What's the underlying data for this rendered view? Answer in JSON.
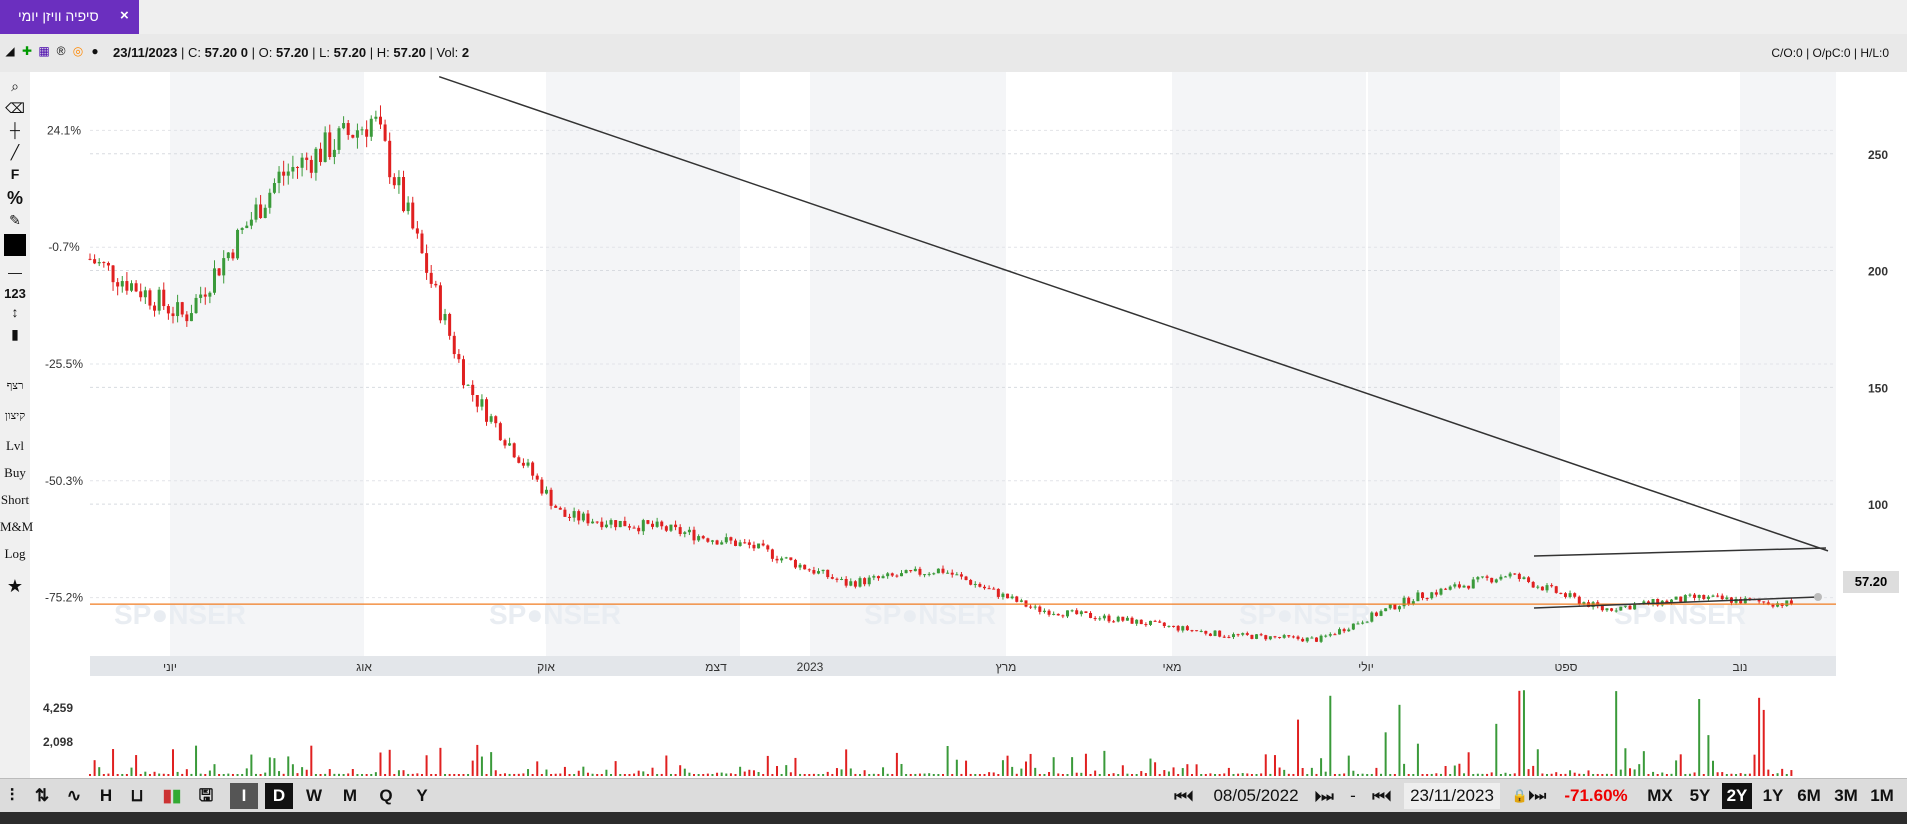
{
  "tab": {
    "title": "סיפיה וויזן יומי",
    "close_icon": "×"
  },
  "info": {
    "date": "23/11/2023",
    "c_label": "C:",
    "c_value": "57.20",
    "c_change": "0",
    "o_label": "O:",
    "o_value": "57.20",
    "l_label": "L:",
    "l_value": "57.20",
    "h_label": "H:",
    "h_value": "57.20",
    "vol_label": "Vol:",
    "vol_value": "2",
    "right": "C/O:0 | O/pC:0 | H/L:0"
  },
  "left_tools": [
    "F",
    "%",
    "123",
    "רצף",
    "קיצון",
    "Lvl",
    "Buy",
    "Short",
    "M&M",
    "Log"
  ],
  "left_axis": [
    "24.1%",
    "-0.7%",
    "-25.5%",
    "-50.3%",
    "-75.2%"
  ],
  "right_axis": [
    "250",
    "200",
    "150",
    "100"
  ],
  "price_tag": "57.20",
  "x_labels": [
    "יוני",
    "אוג",
    "אוק",
    "דצמ",
    "2023",
    "מרץ",
    "מאי",
    "יולי",
    "ספט",
    "נוב"
  ],
  "volume_axis": [
    "4,259",
    "2,098"
  ],
  "watermark": "SP●NSER",
  "bottom": {
    "periods": [
      "D",
      "W",
      "M",
      "Q",
      "Y"
    ],
    "from_date": "08/05/2022",
    "sep": "-",
    "to_date": "23/11/2023",
    "change": "-71.60%",
    "ranges": [
      "MX",
      "5Y",
      "2Y",
      "1Y",
      "6M",
      "3M",
      "1M"
    ],
    "active_range": "2Y"
  },
  "colors": {
    "up": "#3a9a3a",
    "down": "#e02020",
    "orange": "#f07c20",
    "accent": "#6b2fbf"
  },
  "chart_data": {
    "type": "candlestick",
    "x": [
      "2022-05",
      "2022-06",
      "2022-07",
      "2022-08",
      "2022-09",
      "2022-10",
      "2022-11",
      "2022-12",
      "2023-01",
      "2023-02",
      "2023-03",
      "2023-04",
      "2023-05",
      "2023-06",
      "2023-07",
      "2023-08",
      "2023-09",
      "2023-10",
      "2023-11"
    ],
    "close": [
      205,
      180,
      240,
      265,
      150,
      95,
      90,
      82,
      66,
      72,
      55,
      50,
      44,
      42,
      60,
      70,
      55,
      60,
      57.2
    ],
    "volume_ylim": [
      0,
      4259
    ],
    "right_ylim": [
      35,
      285
    ],
    "horizontal_line": 57.2,
    "trendline": [
      [
        0.2,
        283
      ],
      [
        1.0,
        80
      ]
    ]
  }
}
